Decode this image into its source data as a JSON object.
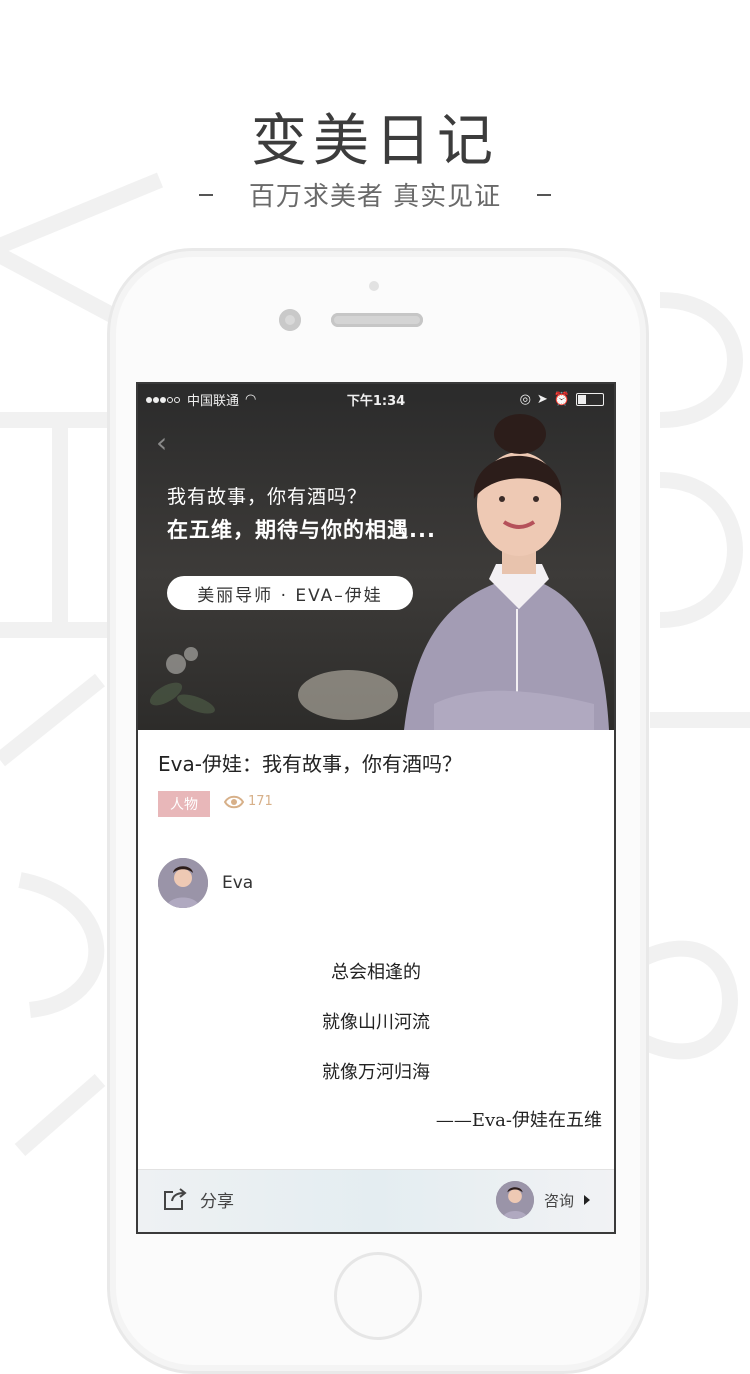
{
  "promo": {
    "title": "变美日记",
    "subtitle": "百万求美者 真实见证"
  },
  "status_bar": {
    "carrier": "中国联通",
    "time": "下午1:34"
  },
  "hero": {
    "line1": "我有故事，你有酒吗？",
    "line2": "在五维，期待与你的相遇...",
    "pill": "美丽导师 · EVA–伊娃"
  },
  "article": {
    "title": "Eva-伊娃：我有故事，你有酒吗？",
    "tag": "人物",
    "views": "171",
    "author": "Eva",
    "poem": [
      "总会相逢的",
      "就像山川河流",
      "就像万河归海"
    ],
    "signature": "——Eva-伊娃在五维"
  },
  "bottom_bar": {
    "share_label": "分享",
    "consult_label": "咨询"
  },
  "colors": {
    "tag_bg": "#e8b7b9",
    "views": "#d7b089"
  }
}
